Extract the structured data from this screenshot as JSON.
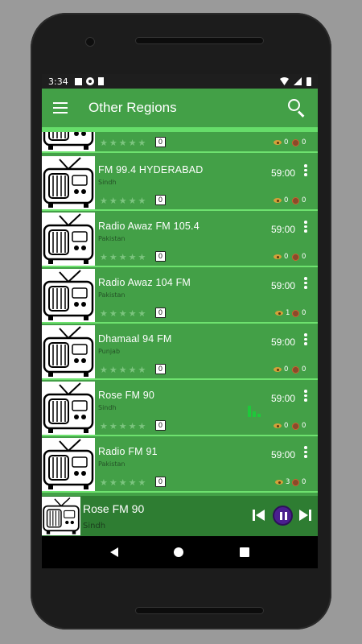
{
  "status_bar": {
    "time": "3:34"
  },
  "app_bar": {
    "title": "Other Regions"
  },
  "rows": [
    {
      "title": "",
      "region": "",
      "time": "",
      "rating": "0",
      "views": "0",
      "likes": "0",
      "playing": false
    },
    {
      "title": "FM 99.4 HYDERABAD",
      "region": "Sindh",
      "time": "59:00",
      "rating": "0",
      "views": "0",
      "likes": "0",
      "playing": false
    },
    {
      "title": "Radio Awaz FM 105.4",
      "region": "Pakistan",
      "time": "59:00",
      "rating": "0",
      "views": "0",
      "likes": "0",
      "playing": false
    },
    {
      "title": "Radio Awaz 104 FM",
      "region": "Pakistan",
      "time": "59:00",
      "rating": "0",
      "views": "1",
      "likes": "0",
      "playing": false
    },
    {
      "title": "Dhamaal 94 FM",
      "region": "Punjab",
      "time": "59:00",
      "rating": "0",
      "views": "0",
      "likes": "0",
      "playing": false
    },
    {
      "title": "Rose FM 90",
      "region": "Sindh",
      "time": "59:00",
      "rating": "0",
      "views": "0",
      "likes": "0",
      "playing": true
    },
    {
      "title": "Radio FM 91",
      "region": "Pakistan",
      "time": "59:00",
      "rating": "0",
      "views": "3",
      "likes": "0",
      "playing": false
    }
  ],
  "player": {
    "title": "Rose FM 90",
    "subtitle": "Sindh"
  },
  "colors": {
    "app_green": "#43a047",
    "divider_green": "#6ee26f",
    "player_green": "#2e7d32",
    "pause_purple": "#4a1f8f",
    "eq_green": "#1ec93a"
  },
  "icons": {
    "menu": "hamburger-icon",
    "search": "search-icon",
    "thumbnail": "tv-icon",
    "overflow": "more-vert-icon",
    "views": "eye-icon",
    "likes": "thumb-icon",
    "previous": "skip-previous-icon",
    "pause": "pause-icon",
    "next": "skip-next-icon"
  }
}
